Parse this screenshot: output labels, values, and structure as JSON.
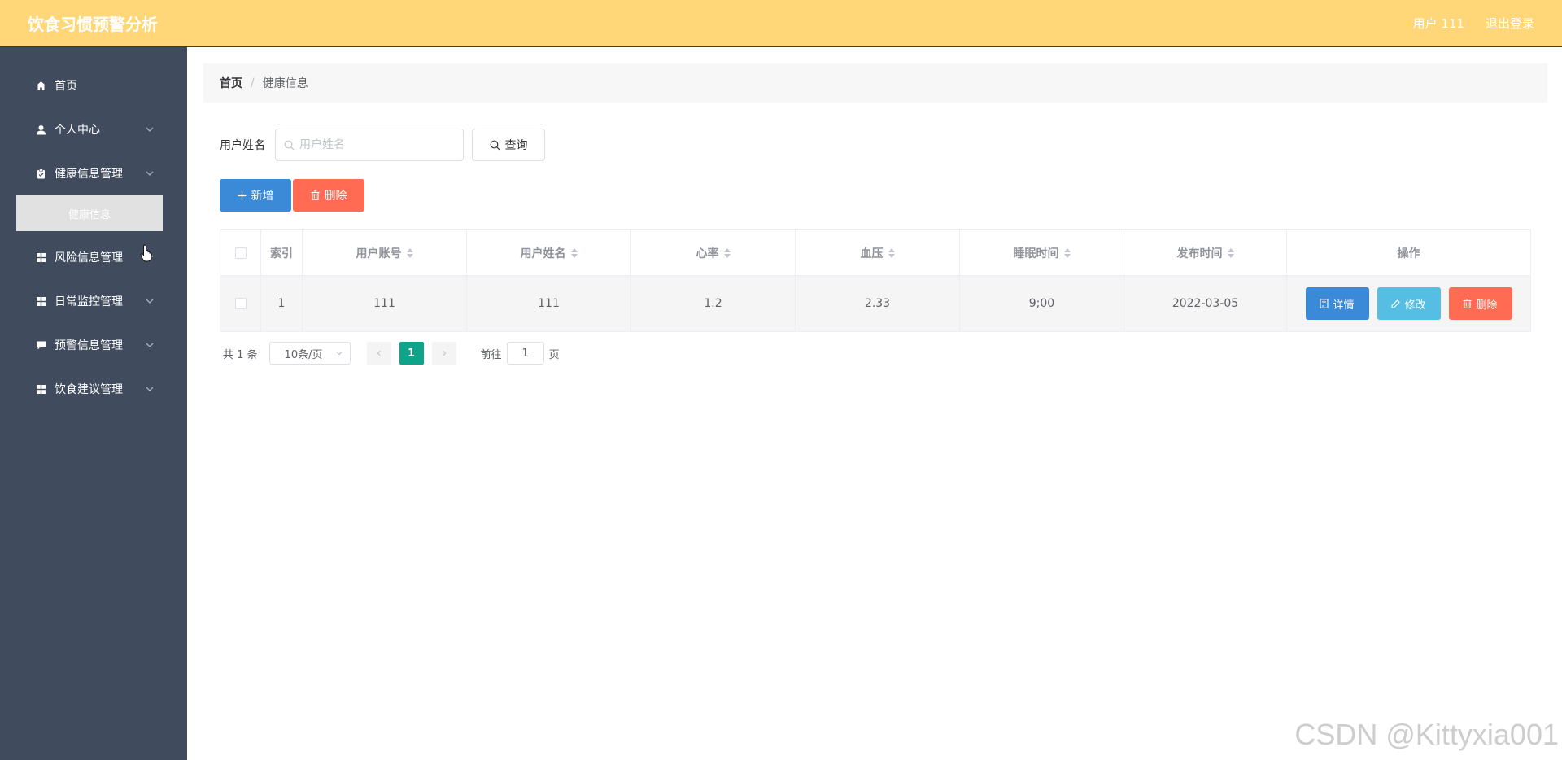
{
  "header": {
    "title": "饮食习惯预警分析",
    "user_label": "用户 111",
    "logout_label": "退出登录"
  },
  "sidebar": {
    "items": [
      {
        "label": "首页",
        "icon": "home-icon"
      },
      {
        "label": "个人中心",
        "icon": "user-icon"
      },
      {
        "label": "健康信息管理",
        "icon": "clipboard-icon"
      },
      {
        "label": "风险信息管理",
        "icon": "grid-icon"
      },
      {
        "label": "日常监控管理",
        "icon": "grid-icon"
      },
      {
        "label": "预警信息管理",
        "icon": "comment-icon"
      },
      {
        "label": "饮食建议管理",
        "icon": "grid-icon"
      }
    ],
    "submenu_active": "健康信息"
  },
  "breadcrumb": {
    "home": "首页",
    "separator": "/",
    "current": "健康信息"
  },
  "search": {
    "label": "用户姓名",
    "placeholder": "用户姓名",
    "value": "",
    "query_button": "查询"
  },
  "actions": {
    "add_label": "新增",
    "delete_label": "删除"
  },
  "table": {
    "columns": [
      "索引",
      "用户账号",
      "用户姓名",
      "心率",
      "血压",
      "睡眠时间",
      "发布时间",
      "操作"
    ],
    "rows": [
      {
        "index": "1",
        "account": "111",
        "name": "111",
        "heart_rate": "1.2",
        "blood_pressure": "2.33",
        "sleep_time": "9;00",
        "publish_time": "2022-03-05"
      }
    ],
    "row_actions": {
      "detail": "详情",
      "edit": "修改",
      "delete": "删除"
    }
  },
  "pagination": {
    "total_text": "共 1 条",
    "page_size": "10条/页",
    "current_page": "1",
    "goto_prefix": "前往",
    "goto_value": "1",
    "goto_suffix": "页"
  },
  "watermark": "CSDN @Kittyxia001",
  "colors": {
    "topbar": "#ffd778",
    "sidebar": "#414b5e",
    "primary": "#3a8ad8",
    "danger": "#ff6b53",
    "info": "#56bde3",
    "page_active": "#0fa48a"
  }
}
